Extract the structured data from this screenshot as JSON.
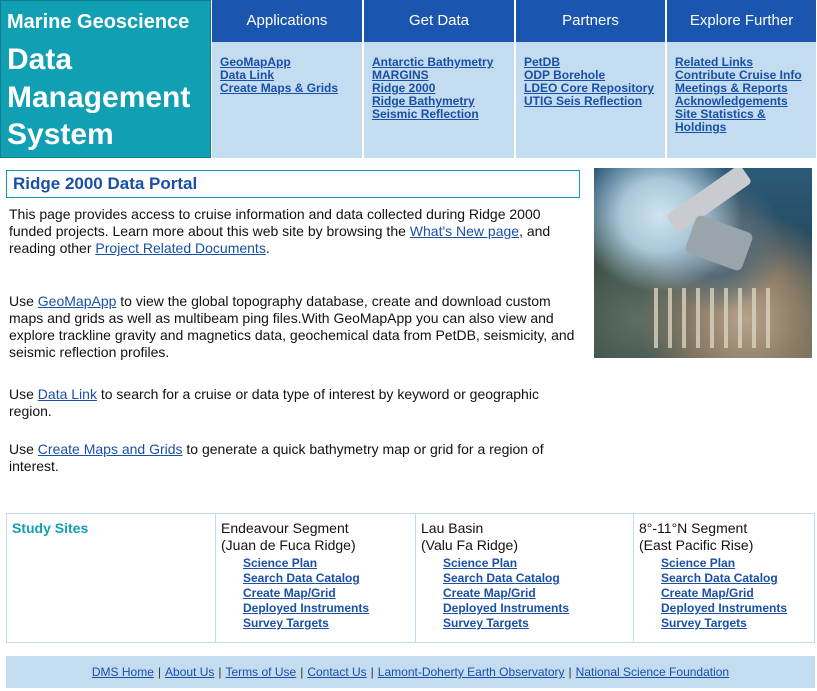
{
  "logo": {
    "line1": "Marine Geoscience",
    "line2": "Data",
    "line3": "Management",
    "line4": "System"
  },
  "nav": [
    {
      "heading": "Applications",
      "links": [
        "GeoMapApp",
        "Data Link",
        "Create Maps & Grids"
      ]
    },
    {
      "heading": "Get Data",
      "links": [
        "Antarctic Bathymetry",
        "MARGINS",
        "Ridge 2000",
        "Ridge Bathymetry",
        "Seismic Reflection"
      ]
    },
    {
      "heading": "Partners",
      "links": [
        "PetDB",
        "ODP Borehole",
        "LDEO Core Repository",
        "UTIG Seis Reflection"
      ]
    },
    {
      "heading": "Explore Further",
      "links": [
        "Related Links",
        "Contribute Cruise Info",
        "Meetings & Reports",
        "Acknowledgements",
        "Site Statistics & Holdings"
      ]
    }
  ],
  "portal_title": "Ridge 2000 Data Portal",
  "para1": {
    "t1": "This page provides access to cruise information and data collected during Ridge 2000 funded projects. Learn more about this web site by browsing the ",
    "link1": "What's New page",
    "t2": ", and reading other ",
    "link2": "Project Related Documents",
    "t3": "."
  },
  "para2": {
    "t1": "Use ",
    "link1": "GeoMapApp",
    "t2": " to view the global topography database, create and download custom maps and grids as well as multibeam ping files.With GeoMapApp you can also view and explore trackline gravity and magnetics data, geochemical data from PetDB, seismicity, and seismic reflection profiles."
  },
  "para3": {
    "t1": "Use ",
    "link1": "Data Link",
    "t2": " to search for a cruise or data type of interest by keyword or geographic region."
  },
  "para4": {
    "t1": "Use ",
    "link1": "Create Maps and Grids",
    "t2": " to generate a quick bathymetry map or grid for a region of interest."
  },
  "study_sites": {
    "label": "Study Sites",
    "sites": [
      {
        "name1": "Endeavour Segment",
        "name2": "(Juan de Fuca Ridge)",
        "links": [
          "Science Plan",
          "Search Data Catalog",
          "Create Map/Grid",
          "Deployed Instruments",
          "Survey Targets"
        ]
      },
      {
        "name1": "Lau Basin",
        "name2": "(Valu Fa Ridge)",
        "links": [
          "Science Plan",
          "Search Data Catalog",
          "Create Map/Grid",
          "Deployed Instruments",
          "Survey Targets"
        ]
      },
      {
        "name1": "8°-11°N Segment",
        "name2": "(East Pacific Rise)",
        "links": [
          "Science Plan",
          "Search Data Catalog",
          "Create Map/Grid",
          "Deployed Instruments",
          "Survey Targets"
        ]
      }
    ]
  },
  "footer": {
    "links": [
      "DMS Home",
      "About Us",
      "Terms of Use",
      "Contact Us",
      "Lamont-Doherty Earth Observatory",
      "National Science Foundation"
    ],
    "separator": "|"
  },
  "colors": {
    "teal": "#11a0b3",
    "nav_blue": "#1a56b0",
    "light_blue": "#c3dcef",
    "link": "#1a4fa8"
  }
}
